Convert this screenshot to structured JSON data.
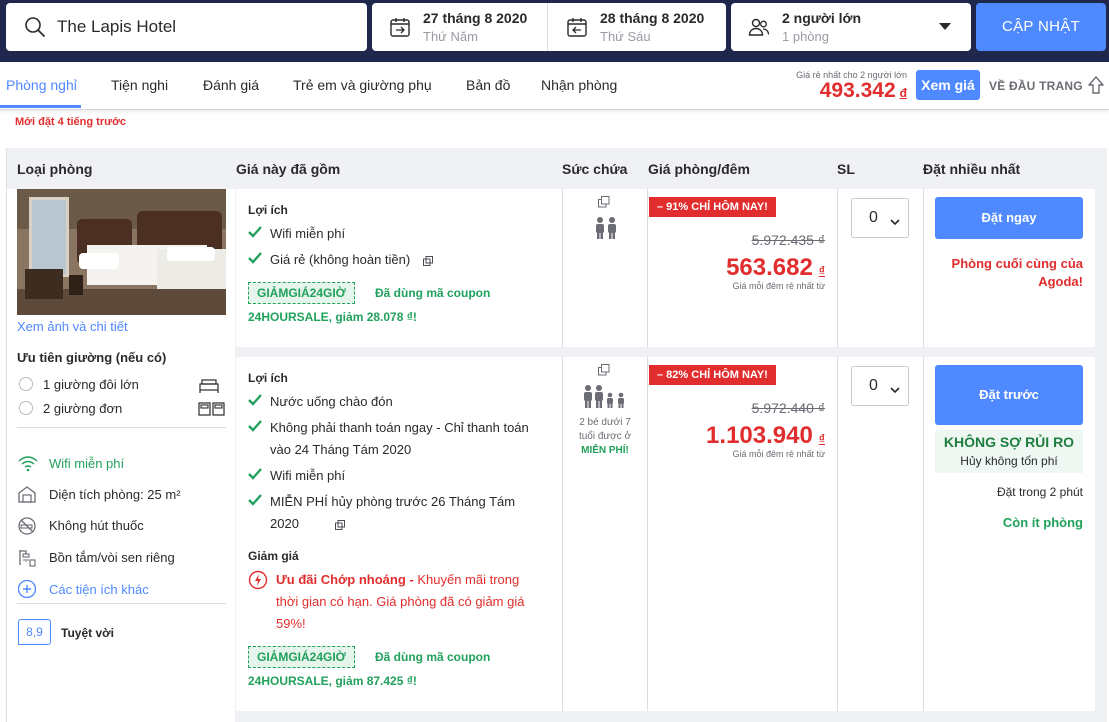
{
  "search": {
    "hotel_name": "The Lapis Hotel",
    "checkin_date": "27 tháng 8 2020",
    "checkin_day": "Thứ Năm",
    "checkout_date": "28 tháng 8 2020",
    "checkout_day": "Thứ Sáu",
    "guests_adults": "2 người lớn",
    "guests_rooms": "1 phòng",
    "update_label": "CẬP NHẬT"
  },
  "nav": {
    "tabs": [
      {
        "label": "Phòng nghỉ",
        "active": true
      },
      {
        "label": "Tiện nghi"
      },
      {
        "label": "Đánh giá"
      },
      {
        "label": "Trẻ em và giường phụ"
      },
      {
        "label": "Bản đồ"
      },
      {
        "label": "Nhận phòng"
      }
    ],
    "cheapest_label": "Giá rẻ nhất cho 2 người lớn",
    "cheapest_price": "493.342",
    "currency": "đ",
    "see_price_label": "Xem giá",
    "back_to_top_label": "VỀ ĐẦU TRANG"
  },
  "recent_booking": "Mới đặt 4 tiếng trước",
  "columns": {
    "room_type": "Loại phòng",
    "includes": "Giá này đã gồm",
    "capacity": "Sức chứa",
    "price": "Giá phòng/đêm",
    "qty": "SL",
    "most_booked": "Đặt nhiều nhất"
  },
  "room": {
    "photo_link": "Xem ảnh và chi tiết",
    "bed_pref_title": "Ưu tiên giường (nếu có)",
    "bed_options": [
      "1 giường đôi lớn",
      "2 giường đơn"
    ],
    "amenities": [
      {
        "label": "Wifi miễn phí",
        "icon": "wifi-icon",
        "style": "green"
      },
      {
        "label": "Diện tích phòng: 25 m²",
        "icon": "house-icon"
      },
      {
        "label": "Không hút thuốc",
        "icon": "no-smoking-icon"
      },
      {
        "label": "Bồn tắm/vòi sen riêng",
        "icon": "shower-icon"
      },
      {
        "label": "Các tiện ích khác",
        "icon": "plus-circle-icon",
        "style": "blue"
      }
    ],
    "score": "8,9",
    "score_label": "Tuyệt vời"
  },
  "offers": [
    {
      "benefits_title": "Lợi ích",
      "benefits": [
        "Wifi miễn phí",
        "Giá rẻ (không hoàn tiền)"
      ],
      "coupon_code": "GIẢMGIÁ24GIỜ",
      "coupon_note_1": "Đã dùng mã coupon",
      "coupon_note_2": "24HOURSALE, giảm 28.078 ₫!",
      "badge": "– 91% CHỈ HÔM NAY!",
      "old_price": "5.972.435 ₫",
      "new_price": "563.682",
      "currency": "₫",
      "price_note": "Giá mỗi đêm rẻ nhất từ",
      "qty": "0",
      "book_label": "Đặt ngay",
      "urgency": "Phòng cuối cùng của Agoda!"
    },
    {
      "benefits_title": "Lợi ích",
      "benefits": [
        "Nước uống chào đón",
        "Không phải thanh toán ngay - Chỉ thanh toán vào 24 Tháng Tám 2020",
        "Wifi miễn phí",
        "MIỄN PHÍ hủy phòng trước 26 Tháng Tám 2020"
      ],
      "discount_title": "Giảm giá",
      "flash_title": "Ưu đãi Chớp nhoáng -",
      "flash_text": "Khuyến mãi trong thời gian có hạn. Giá phòng đã có giảm giá 59%!",
      "coupon_code": "GIẢMGIÁ24GIỜ",
      "coupon_note_1": "Đã dùng mã coupon",
      "coupon_note_2": "24HOURSALE, giảm 87.425 ₫!",
      "kids_note": "2 bé dưới 7 tuổi được ở",
      "kids_free": "MIỄN PHÍ!",
      "badge": "– 82% CHỈ HÔM NAY!",
      "old_price": "5.972.440 ₫",
      "new_price": "1.103.940",
      "currency": "₫",
      "price_note": "Giá mỗi đêm rẻ nhất từ",
      "qty": "0",
      "book_label": "Đặt trước",
      "norisk_title": "KHÔNG SỢ RỦI RO",
      "norisk_sub": "Hủy không tốn phí",
      "booked_note": "Đặt trong 2 phút",
      "few_left": "Còn ít phòng"
    }
  ],
  "colors": {
    "navy": "#20274d",
    "accent": "#4f89ff",
    "red": "#e12d2d",
    "green": "#21a15c"
  }
}
